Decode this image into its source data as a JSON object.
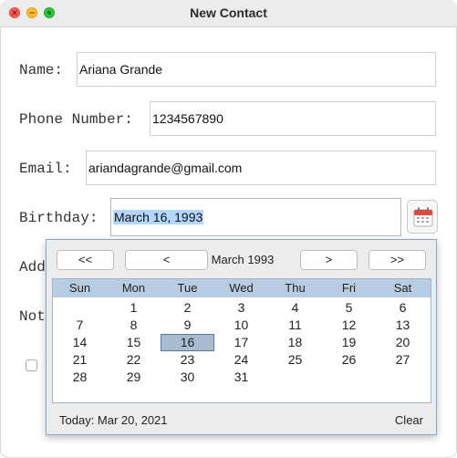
{
  "window": {
    "title": "New Contact"
  },
  "form": {
    "name_label": "Name:",
    "name_value": "Ariana Grande",
    "phone_label": "Phone Number:",
    "phone_value": "1234567890",
    "email_label": "Email:",
    "email_value": "ariandagrande@gmail.com",
    "birthday_label": "Birthday:",
    "birthday_value": "March 16, 1993",
    "address_label_partial": "Add",
    "notes_label_partial": "Not"
  },
  "calendar": {
    "prev_year": "<<",
    "prev_month": "<",
    "next_month": ">",
    "next_year": ">>",
    "month_year": "March  1993",
    "weekdays": [
      "Sun",
      "Mon",
      "Tue",
      "Wed",
      "Thu",
      "Fri",
      "Sat"
    ],
    "weeks": [
      [
        "",
        "1",
        "2",
        "3",
        "4",
        "5",
        "6"
      ],
      [
        "7",
        "8",
        "9",
        "10",
        "11",
        "12",
        "13"
      ],
      [
        "14",
        "15",
        "16",
        "17",
        "18",
        "19",
        "20"
      ],
      [
        "21",
        "22",
        "23",
        "24",
        "25",
        "26",
        "27"
      ],
      [
        "28",
        "29",
        "30",
        "31",
        "",
        "",
        ""
      ]
    ],
    "selected_day": "16",
    "today_text": "Today:  Mar 20, 2021",
    "clear_label": "Clear"
  },
  "icons": {
    "calendar": "calendar-icon",
    "close": "close-icon",
    "minimize": "minimize-icon",
    "maximize": "maximize-icon"
  },
  "colors": {
    "weekday_header": "#b8cde4",
    "selected_day": "#a9bcd0",
    "text_selection": "#b3d7ff"
  }
}
